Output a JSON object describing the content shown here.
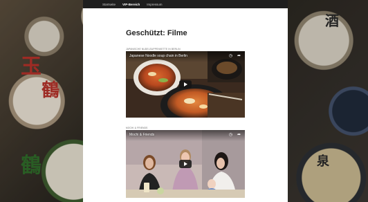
{
  "nav": {
    "items": [
      {
        "label": "Startseite",
        "active": false
      },
      {
        "label": "VIP-Bereich",
        "active": true
      },
      {
        "label": "Impressum",
        "active": false
      }
    ]
  },
  "page": {
    "title": "Geschützt: Filme"
  },
  "videos": [
    {
      "caption": "JAPANISCHE NUDELSUPPENKETTE IN BERLIN",
      "title": "Japanese Noodle soup chain in Berlin"
    },
    {
      "caption": "MOCHI & FRIENDS",
      "title": "Mochi & Friends"
    }
  ],
  "icons": {
    "clock": "clock-icon",
    "share": "share-icon",
    "play": "play-icon"
  },
  "colors": {
    "nav_bg": "#1e1e1e",
    "page_bg": "#ffffff",
    "title": "#222222"
  }
}
